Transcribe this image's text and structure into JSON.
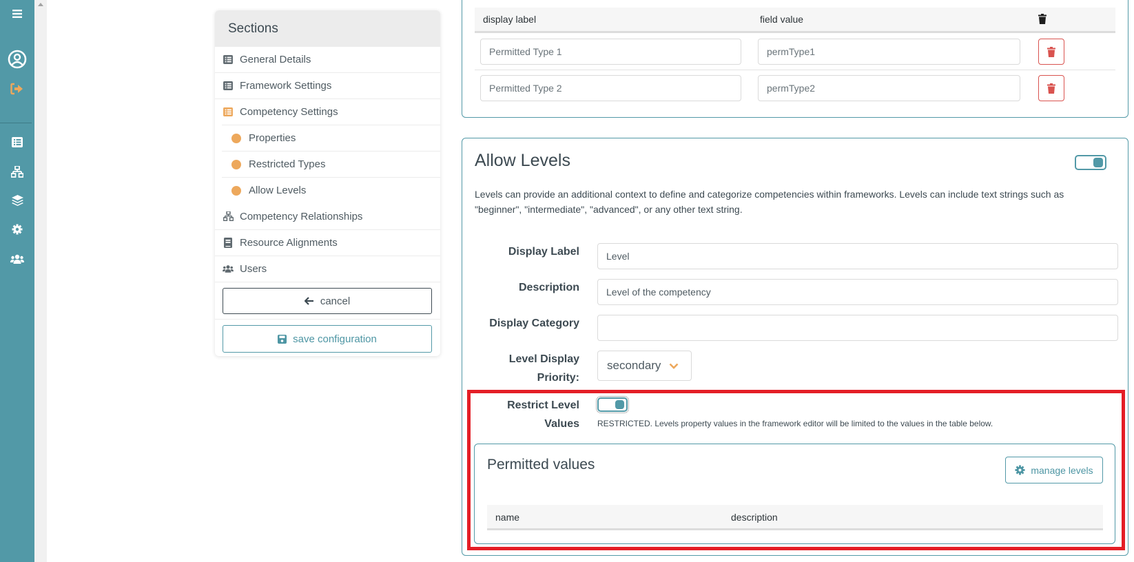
{
  "rail": {
    "icons": [
      "menu-icon",
      "user-circle-icon",
      "sign-out-icon",
      "list-icon",
      "sitemap-icon",
      "layers-icon",
      "gear-icon",
      "users-icon"
    ]
  },
  "sections": {
    "title": "Sections",
    "items": [
      {
        "label": "General Details",
        "icon": "list-icon"
      },
      {
        "label": "Framework Settings",
        "icon": "list-icon"
      },
      {
        "label": "Competency Settings",
        "icon": "list-icon",
        "active": true
      },
      {
        "label": "Properties",
        "icon": "dot-icon",
        "sub": true
      },
      {
        "label": "Restricted Types",
        "icon": "dot-icon",
        "sub": true
      },
      {
        "label": "Allow Levels",
        "icon": "dot-icon",
        "sub": true
      },
      {
        "label": "Competency Relationships",
        "icon": "sitemap-icon"
      },
      {
        "label": "Resource Alignments",
        "icon": "book-icon"
      },
      {
        "label": "Users",
        "icon": "users-icon"
      }
    ],
    "cancel_label": "cancel",
    "save_label": "save configuration"
  },
  "restricted_types": {
    "columns": [
      "display label",
      "field value"
    ],
    "rows": [
      {
        "display_label": "Permitted Type 1",
        "field_value": "permType1"
      },
      {
        "display_label": "Permitted Type 2",
        "field_value": "permType2"
      }
    ]
  },
  "allow_levels": {
    "title": "Allow Levels",
    "enabled": true,
    "description": "Levels can provide an additional context to define and categorize competencies within frameworks. Levels can include text strings such as \"beginner\", \"intermediate\", \"advanced\", or any other text string.",
    "fields": {
      "display_label": {
        "label": "Display Label",
        "value": "Level"
      },
      "description": {
        "label": "Description",
        "value": "Level of the competency"
      },
      "display_category": {
        "label": "Display Category",
        "value": ""
      },
      "priority": {
        "label_line1": "Level Display",
        "label_line2": "Priority:",
        "value": "secondary"
      }
    },
    "restrict": {
      "label_line1": "Restrict Level",
      "label_line2": "Values",
      "enabled": true,
      "note": "RESTRICTED. Levels property values in the framework editor will be limited to the values in the table below."
    },
    "permitted_values": {
      "title": "Permitted values",
      "manage_label": "manage levels",
      "columns": [
        "name",
        "description"
      ],
      "rows": []
    }
  },
  "colors": {
    "accent": "#5299a7",
    "orange": "#eda85c",
    "danger": "#d9534f",
    "highlight": "#e41e26"
  }
}
